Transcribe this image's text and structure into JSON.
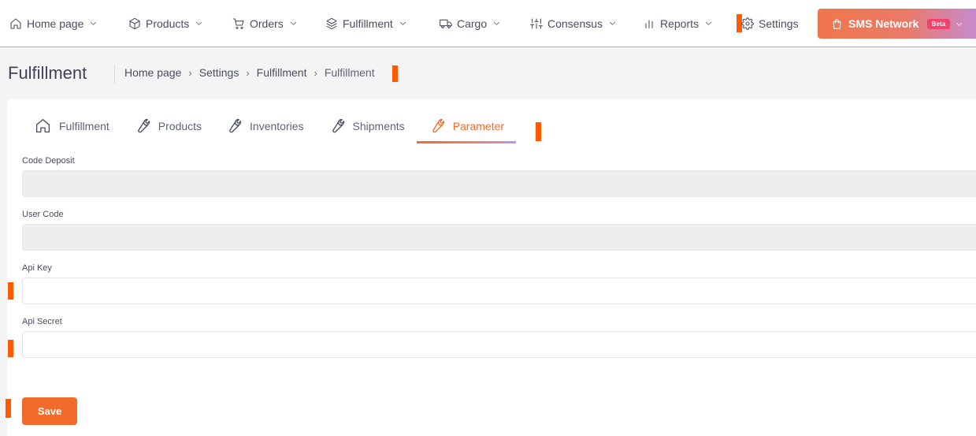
{
  "nav": {
    "items": [
      {
        "label": "Home page",
        "icon": "home-icon"
      },
      {
        "label": "Products",
        "icon": "box-icon"
      },
      {
        "label": "Orders",
        "icon": "cart-icon"
      },
      {
        "label": "Fulfillment",
        "icon": "fulfillment-icon"
      },
      {
        "label": "Cargo",
        "icon": "truck-icon"
      },
      {
        "label": "Consensus",
        "icon": "sliders-icon"
      },
      {
        "label": "Reports",
        "icon": "bar-chart-icon"
      },
      {
        "label": "Settings",
        "icon": "gear-icon"
      }
    ],
    "sms": {
      "label": "SMS Network",
      "badge": "Beta",
      "icon": "shopping-bag-icon"
    }
  },
  "page": {
    "title": "Fulfillment",
    "breadcrumb": [
      "Home page",
      "Settings",
      "Fulfillment",
      "Fulfillment"
    ]
  },
  "tabs": [
    {
      "label": "Fulfillment",
      "icon": "home-icon",
      "active": false
    },
    {
      "label": "Products",
      "icon": "wrench-icon",
      "active": false
    },
    {
      "label": "Inventories",
      "icon": "wrench-icon",
      "active": false
    },
    {
      "label": "Shipments",
      "icon": "wrench-icon",
      "active": false
    },
    {
      "label": "Parameter",
      "icon": "wrench-icon",
      "active": true
    }
  ],
  "form": {
    "code_deposit": {
      "label": "Code Deposit",
      "value": ""
    },
    "user_code": {
      "label": "User Code",
      "value": ""
    },
    "api_key": {
      "label": "Api Key",
      "value": ""
    },
    "api_secret": {
      "label": "Api Secret",
      "value": ""
    },
    "save_label": "Save"
  },
  "colors": {
    "accent": "#f26a2a",
    "marker": "#ff5a00",
    "beta_badge": "#f1416c"
  }
}
